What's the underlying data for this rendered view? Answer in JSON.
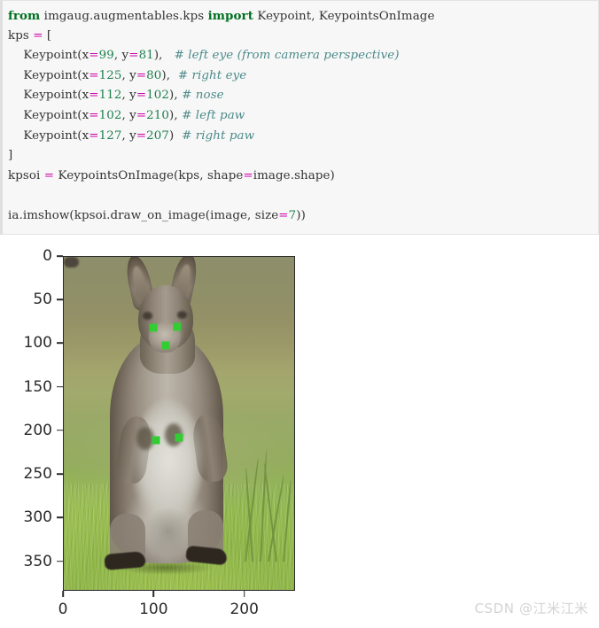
{
  "code_block": {
    "language": "python",
    "background_color": "#f7f7f7",
    "border_color": "#e3e3e3",
    "colors": {
      "keyword": "#007020",
      "number": "#208050",
      "operator": "#cc00aa",
      "comment": "#4c8a8a",
      "text": "#333333"
    },
    "lines": [
      [
        {
          "t": "from",
          "c": "kw"
        },
        {
          "t": " imgaug.augmentables.kps ",
          "c": "plain"
        },
        {
          "t": "import",
          "c": "kw"
        },
        {
          "t": " Keypoint, KeypointsOnImage",
          "c": "plain"
        }
      ],
      [
        {
          "t": "kps ",
          "c": "plain"
        },
        {
          "t": "=",
          "c": "op"
        },
        {
          "t": " [",
          "c": "plain"
        }
      ],
      [
        {
          "t": "    Keypoint(x",
          "c": "plain"
        },
        {
          "t": "=",
          "c": "op"
        },
        {
          "t": "99",
          "c": "num"
        },
        {
          "t": ", y",
          "c": "plain"
        },
        {
          "t": "=",
          "c": "op"
        },
        {
          "t": "81",
          "c": "num"
        },
        {
          "t": "),   ",
          "c": "plain"
        },
        {
          "t": "# left eye (from camera perspective)",
          "c": "cmt"
        }
      ],
      [
        {
          "t": "    Keypoint(x",
          "c": "plain"
        },
        {
          "t": "=",
          "c": "op"
        },
        {
          "t": "125",
          "c": "num"
        },
        {
          "t": ", y",
          "c": "plain"
        },
        {
          "t": "=",
          "c": "op"
        },
        {
          "t": "80",
          "c": "num"
        },
        {
          "t": "),  ",
          "c": "plain"
        },
        {
          "t": "# right eye",
          "c": "cmt"
        }
      ],
      [
        {
          "t": "    Keypoint(x",
          "c": "plain"
        },
        {
          "t": "=",
          "c": "op"
        },
        {
          "t": "112",
          "c": "num"
        },
        {
          "t": ", y",
          "c": "plain"
        },
        {
          "t": "=",
          "c": "op"
        },
        {
          "t": "102",
          "c": "num"
        },
        {
          "t": "), ",
          "c": "plain"
        },
        {
          "t": "# nose",
          "c": "cmt"
        }
      ],
      [
        {
          "t": "    Keypoint(x",
          "c": "plain"
        },
        {
          "t": "=",
          "c": "op"
        },
        {
          "t": "102",
          "c": "num"
        },
        {
          "t": ", y",
          "c": "plain"
        },
        {
          "t": "=",
          "c": "op"
        },
        {
          "t": "210",
          "c": "num"
        },
        {
          "t": "), ",
          "c": "plain"
        },
        {
          "t": "# left paw",
          "c": "cmt"
        }
      ],
      [
        {
          "t": "    Keypoint(x",
          "c": "plain"
        },
        {
          "t": "=",
          "c": "op"
        },
        {
          "t": "127",
          "c": "num"
        },
        {
          "t": ", y",
          "c": "plain"
        },
        {
          "t": "=",
          "c": "op"
        },
        {
          "t": "207",
          "c": "num"
        },
        {
          "t": ")  ",
          "c": "plain"
        },
        {
          "t": "# right paw",
          "c": "cmt"
        }
      ],
      [
        {
          "t": "]",
          "c": "plain"
        }
      ],
      [
        {
          "t": "kpsoi ",
          "c": "plain"
        },
        {
          "t": "=",
          "c": "op"
        },
        {
          "t": " KeypointsOnImage(kps, shape",
          "c": "plain"
        },
        {
          "t": "=",
          "c": "op"
        },
        {
          "t": "image.shape)",
          "c": "plain"
        }
      ],
      [
        {
          "t": "",
          "c": "plain"
        }
      ],
      [
        {
          "t": "ia.imshow(kpsoi.draw_on_image(image, size",
          "c": "plain"
        },
        {
          "t": "=",
          "c": "op"
        },
        {
          "t": "7",
          "c": "num"
        },
        {
          "t": "))",
          "c": "plain"
        }
      ]
    ]
  },
  "chart_data": {
    "type": "scatter",
    "title": "",
    "xlabel": "",
    "ylabel": "",
    "xlim": [
      0,
      256
    ],
    "ylim": [
      384,
      0
    ],
    "grid": false,
    "legend": null,
    "xticks": [
      0,
      100,
      200
    ],
    "yticks": [
      0,
      50,
      100,
      150,
      200,
      250,
      300,
      350
    ],
    "image_subject": "wallaby standing on grass",
    "keypoint_color": "#32cd32",
    "keypoint_size": 7,
    "keypoints": [
      {
        "label": "left eye (from camera perspective)",
        "x": 99,
        "y": 81
      },
      {
        "label": "right eye",
        "x": 125,
        "y": 80
      },
      {
        "label": "nose",
        "x": 112,
        "y": 102
      },
      {
        "label": "left paw",
        "x": 102,
        "y": 210
      },
      {
        "label": "right paw",
        "x": 127,
        "y": 207
      }
    ]
  },
  "watermark": {
    "text": "CSDN @江米江米",
    "color": "#d3d3d3"
  }
}
